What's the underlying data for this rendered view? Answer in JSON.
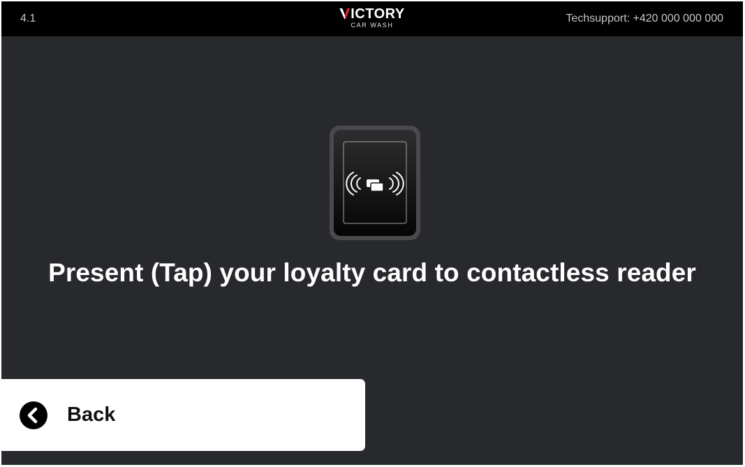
{
  "header": {
    "version": "4.1",
    "brand": {
      "name_first": "V",
      "name_rest": "ICTORY",
      "subtitle": "CAR WASH",
      "accent_color": "#e3262f"
    },
    "support": "Techsupport: +420 000 000 000"
  },
  "main": {
    "reader_icon": "contactless-card-reader-icon",
    "message": "Present (Tap) your loyalty card to contactless reader"
  },
  "footer": {
    "back": {
      "label": "Back",
      "icon": "chevron-left-icon"
    }
  },
  "colors": {
    "background": "#28292d",
    "header": "#000000",
    "button": "#ffffff"
  }
}
